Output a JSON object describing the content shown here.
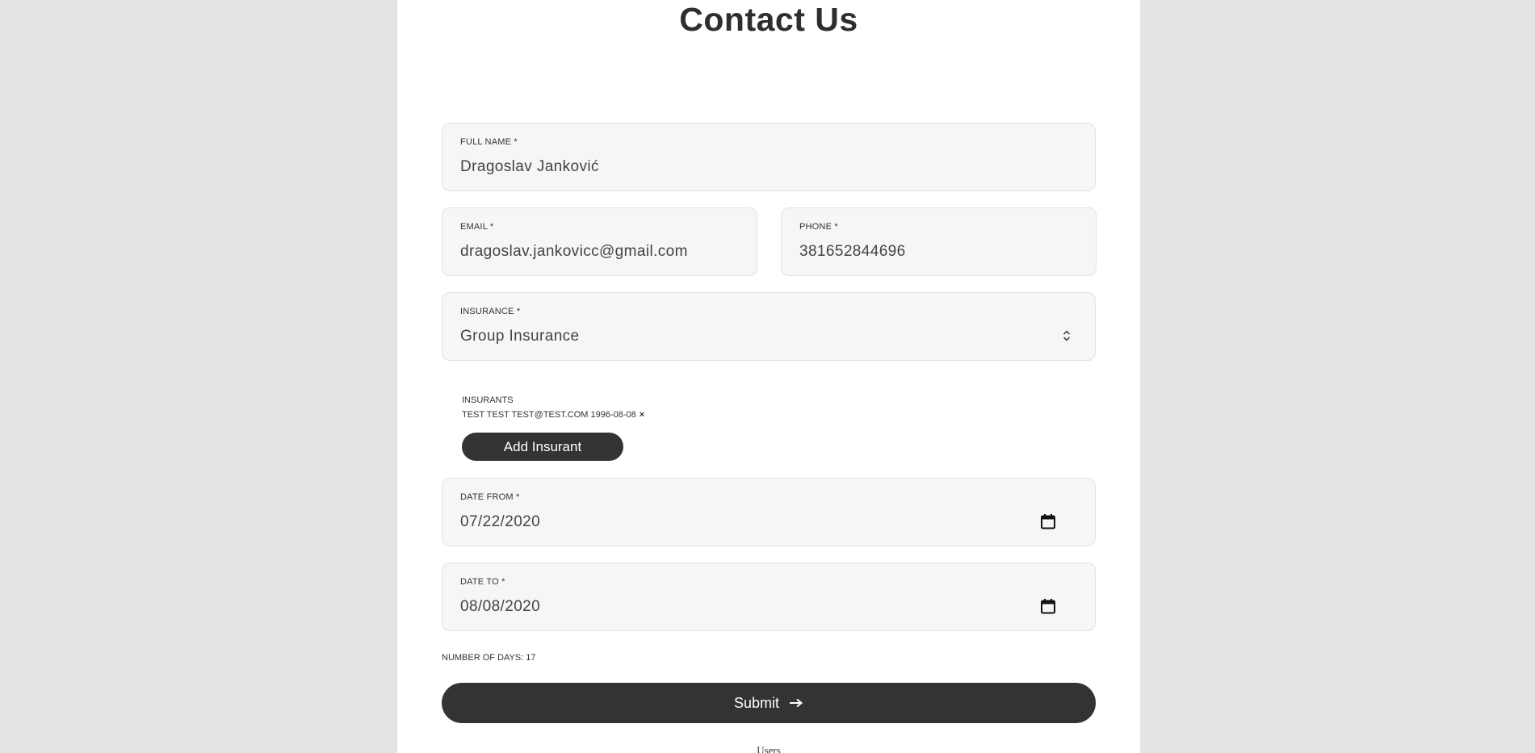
{
  "page": {
    "title": "Contact Us"
  },
  "form": {
    "full_name": {
      "label": "FULL NAME *",
      "value": "Dragoslav Janković"
    },
    "email": {
      "label": "EMAIL *",
      "value": "dragoslav.jankovicc@gmail.com"
    },
    "phone": {
      "label": "PHONE *",
      "value": "381652844696"
    },
    "insurance": {
      "label": "INSURANCE *",
      "value": "Group Insurance"
    },
    "insurants": {
      "label": "INSURANTS",
      "items": [
        {
          "text": "TEST TEST TEST@TEST.COM 1996-08-08",
          "remove": "×"
        }
      ],
      "add_label": "Add Insurant"
    },
    "date_from": {
      "label": "DATE FROM *",
      "value": "07/22/2020"
    },
    "date_to": {
      "label": "DATE TO *",
      "value": "08/08/2020"
    },
    "number_of_days": "NUMBER OF DAYS: 17",
    "submit_label": "Submit"
  },
  "footer": {
    "users_link": "Users"
  },
  "colors": {
    "background": "#e4e4e4",
    "panel": "#ffffff",
    "field_bg": "#f6f6f6",
    "button_bg": "#333333",
    "button_text": "#ffffff"
  },
  "icons": {
    "select": "chevron-up-down-icon",
    "calendar": "calendar-icon",
    "submit": "arrow-right-icon",
    "remove": "close-icon"
  }
}
